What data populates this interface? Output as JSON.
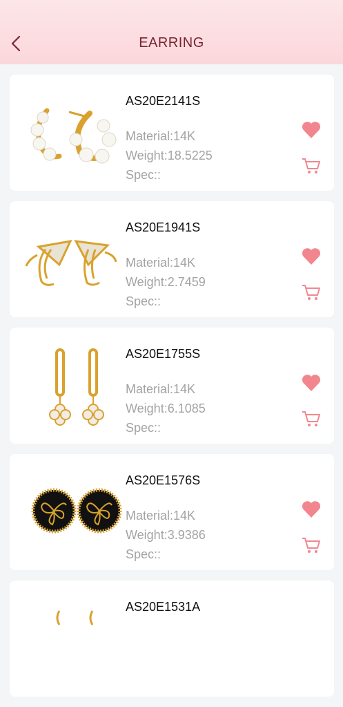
{
  "header": {
    "title": "EARRING"
  },
  "colors": {
    "accent": "#f2868f",
    "title": "#7a2432",
    "header_bg": "#fbd9de"
  },
  "products": [
    {
      "code": "AS20E2141S",
      "material": "Material:14K",
      "weight": "Weight:18.5225",
      "spec": "Spec::",
      "image": "pearl-hoop-earrings"
    },
    {
      "code": "AS20E1941S",
      "material": "Material:14K",
      "weight": "Weight:2.7459",
      "spec": "Spec::",
      "image": "crystal-triangle-ear-cuffs"
    },
    {
      "code": "AS20E1755S",
      "material": "Material:14K",
      "weight": "Weight:6.1085",
      "spec": "Spec::",
      "image": "clover-drop-earrings"
    },
    {
      "code": "AS20E1576S",
      "material": "Material:14K",
      "weight": "Weight:3.9386",
      "spec": "Spec::",
      "image": "butterfly-stud-earrings"
    },
    {
      "code": "AS20E1531A",
      "material": "",
      "weight": "",
      "spec": "",
      "image": "hoop-earrings-partial"
    }
  ]
}
